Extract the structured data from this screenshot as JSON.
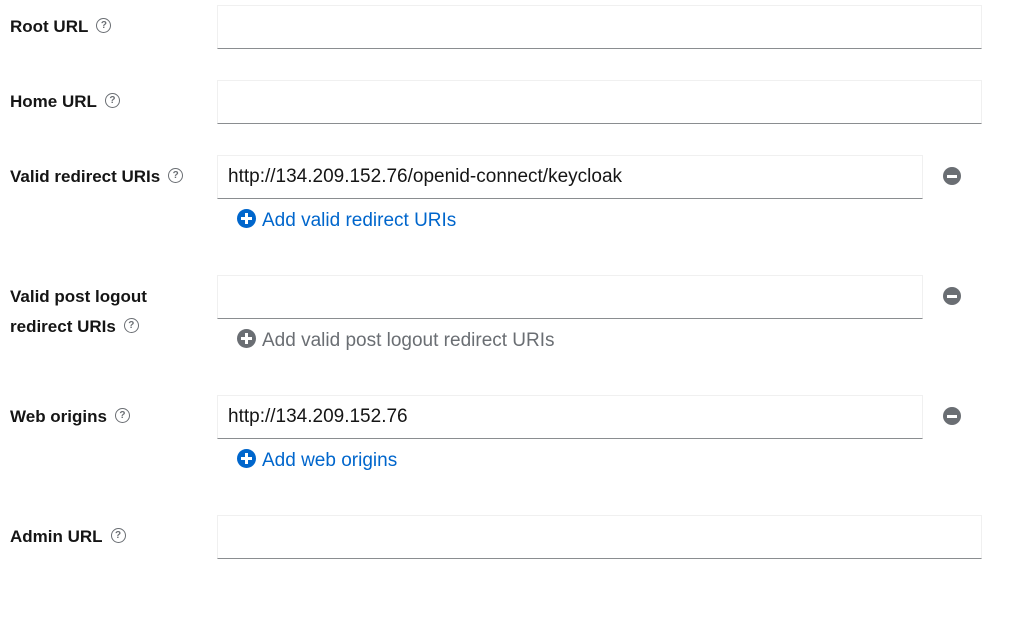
{
  "fields": {
    "root_url": {
      "label": "Root URL",
      "value": ""
    },
    "home_url": {
      "label": "Home URL",
      "value": ""
    },
    "valid_redirect_uris": {
      "label": "Valid redirect URIs",
      "value": "http://134.209.152.76/openid-connect/keycloak",
      "add_label": "Add valid redirect URIs"
    },
    "valid_post_logout_redirect_uris": {
      "label_line1": "Valid post logout",
      "label_line2": "redirect URIs",
      "value": "",
      "add_label": "Add valid post logout redirect URIs"
    },
    "web_origins": {
      "label": "Web origins",
      "value": "http://134.209.152.76",
      "add_label": "Add web origins"
    },
    "admin_url": {
      "label": "Admin URL",
      "value": ""
    }
  },
  "icons": {
    "help": "?",
    "remove": "minus-circle-icon",
    "add": "plus-circle-icon"
  },
  "colors": {
    "link": "#0066cc",
    "muted": "#6a6e73",
    "text": "#151515"
  }
}
